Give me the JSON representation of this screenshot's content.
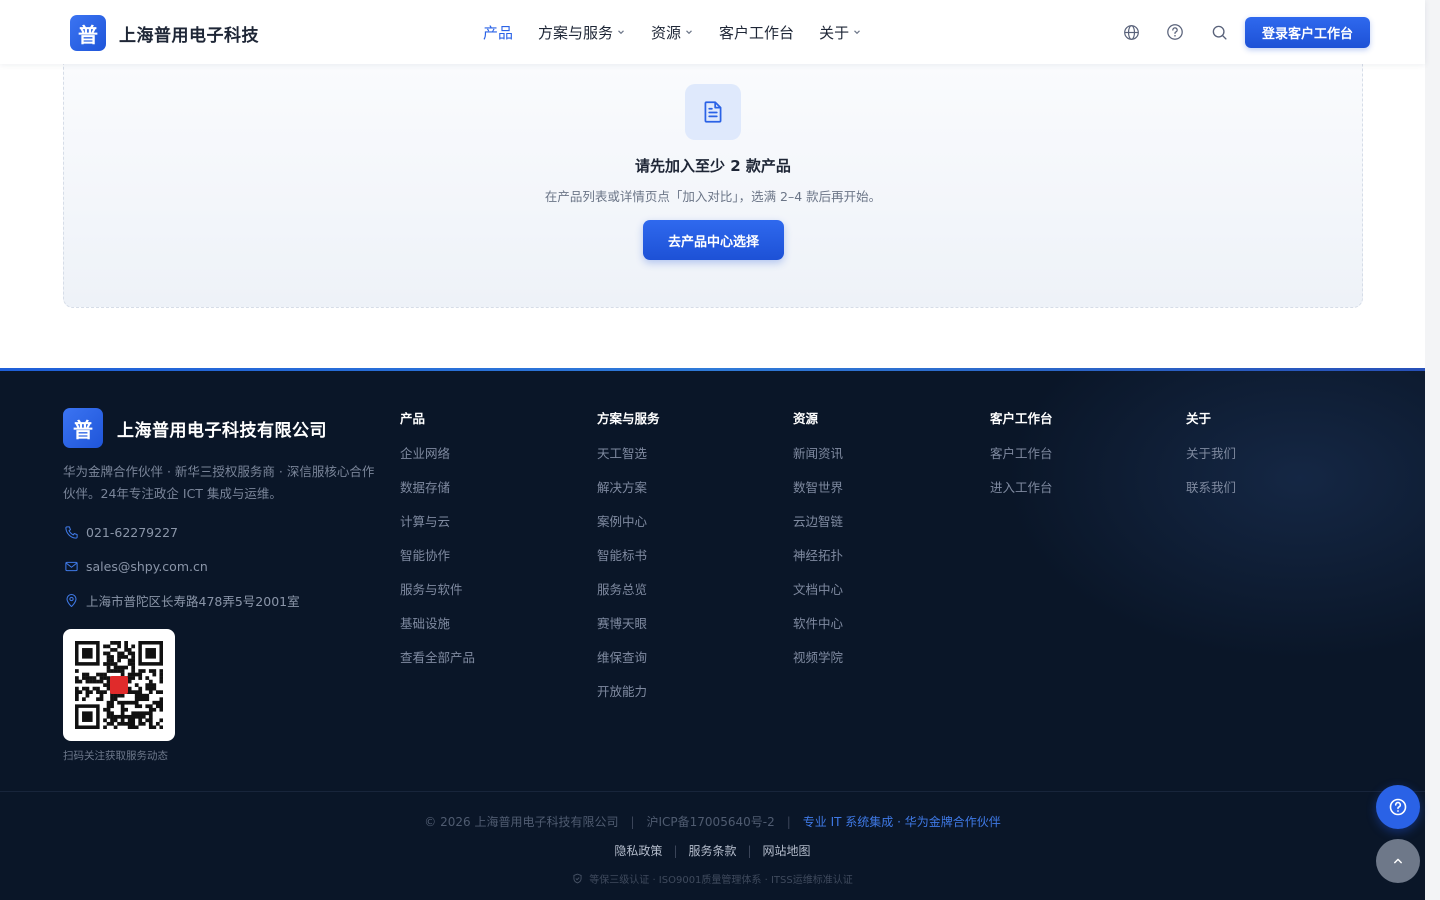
{
  "header": {
    "logo_char": "普",
    "brand": "上海普用电子科技",
    "nav": [
      {
        "label": "产品"
      },
      {
        "label": "方案与服务"
      },
      {
        "label": "资源"
      },
      {
        "label": "客户工作台"
      },
      {
        "label": "关于"
      }
    ],
    "login_label": "登录客户工作台"
  },
  "empty_state": {
    "title": "请先加入至少 2 款产品",
    "desc": "在产品列表或详情页点「加入对比」，选满 2–4 款后再开始。",
    "button": "去产品中心选择"
  },
  "footer": {
    "logo_char": "普",
    "company": "上海普用电子科技有限公司",
    "desc": "华为金牌合作伙伴 · 新华三授权服务商 · 深信服核心合作伙伴。24年专注政企 ICT 集成与运维。",
    "phone": "021-62279227",
    "email": "sales@shpy.com.cn",
    "address": "上海市普陀区长寿路478弄5号2001室",
    "qr_caption": "扫码关注获取服务动态",
    "columns": [
      {
        "title": "产品",
        "links": [
          "企业网络",
          "数据存储",
          "计算与云",
          "智能协作",
          "服务与软件",
          "基础设施",
          "查看全部产品"
        ]
      },
      {
        "title": "方案与服务",
        "links": [
          "天工智选",
          "解决方案",
          "案例中心",
          "智能标书",
          "服务总览",
          "赛博天眼",
          "维保查询",
          "开放能力"
        ]
      },
      {
        "title": "资源",
        "links": [
          "新闻资讯",
          "数智世界",
          "云边智链",
          "神经拓扑",
          "文档中心",
          "软件中心",
          "视频学院"
        ]
      },
      {
        "title": "客户工作台",
        "links": [
          "客户工作台",
          "进入工作台"
        ]
      },
      {
        "title": "关于",
        "links": [
          "关于我们",
          "联系我们"
        ]
      }
    ],
    "copyright": "© 2026 上海普用电子科技有限公司",
    "icp": "沪ICP备17005640号-2",
    "slogan": "专业 IT 系统集成 · 华为金牌合作伙伴",
    "legal": [
      "隐私政策",
      "服务条款",
      "网站地图"
    ],
    "certs": "等保三级认证 · ISO9001质量管理体系 · ITSS运维标准认证"
  },
  "colors": {
    "accent": "#2a62e6",
    "footer_bg": "#0a1628"
  }
}
